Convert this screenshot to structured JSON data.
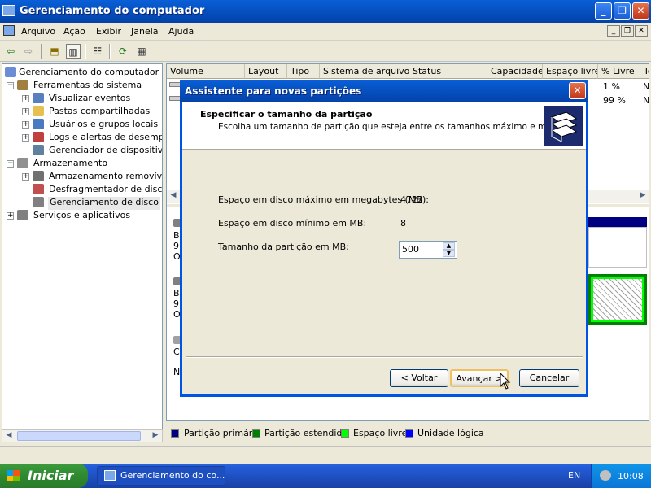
{
  "window": {
    "title": "Gerenciamento do computador"
  },
  "menu": [
    "Arquivo",
    "Ação",
    "Exibir",
    "Janela",
    "Ajuda"
  ],
  "tree": {
    "root": "Gerenciamento do computador (local",
    "items": [
      "Ferramentas do sistema",
      "Visualizar eventos",
      "Pastas compartilhadas",
      "Usuários e grupos locais",
      "Logs e alertas de desempenh",
      "Gerenciador de dispositivos",
      "Armazenamento",
      "Armazenamento removível",
      "Desfragmentador de disco",
      "Gerenciamento de disco",
      "Serviços e aplicativos"
    ]
  },
  "columns": [
    "Volume",
    "Layout",
    "Tipo",
    "Sistema de arquivos",
    "Status",
    "Capacidade",
    "Espaço livre",
    "% Livre",
    "To"
  ],
  "rows": [
    {
      "pct": "1 %",
      "tail": "N"
    },
    {
      "pct": "99 %",
      "tail": "N"
    }
  ],
  "disk_labels": [
    "B",
    "9",
    "O",
    "B",
    "9",
    "O",
    "C",
    "N"
  ],
  "legend": [
    "Partição primária",
    "Partição estendida",
    "Espaço livre",
    "Unidade lógica"
  ],
  "legend_colors": [
    "#000080",
    "#008000",
    "#00ff00",
    "#0000ff"
  ],
  "dialog": {
    "title": "Assistente para novas partições",
    "heading": "Especificar o tamanho da partição",
    "subheading": "Escolha um tamanho de partição que esteja entre os tamanhos máximo e mínimo.",
    "max_label": "Espaço em disco máximo em megabytes (MB):",
    "max_value": "4722",
    "min_label": "Espaço em disco mínimo em MB:",
    "min_value": "8",
    "size_label": "Tamanho da partição em MB:",
    "size_value": "500",
    "back": "< Voltar",
    "next": "Avançar >",
    "cancel": "Cancelar"
  },
  "taskbar": {
    "start": "Iniciar",
    "task": "Gerenciamento do co...",
    "lang": "EN",
    "time": "10:08"
  }
}
